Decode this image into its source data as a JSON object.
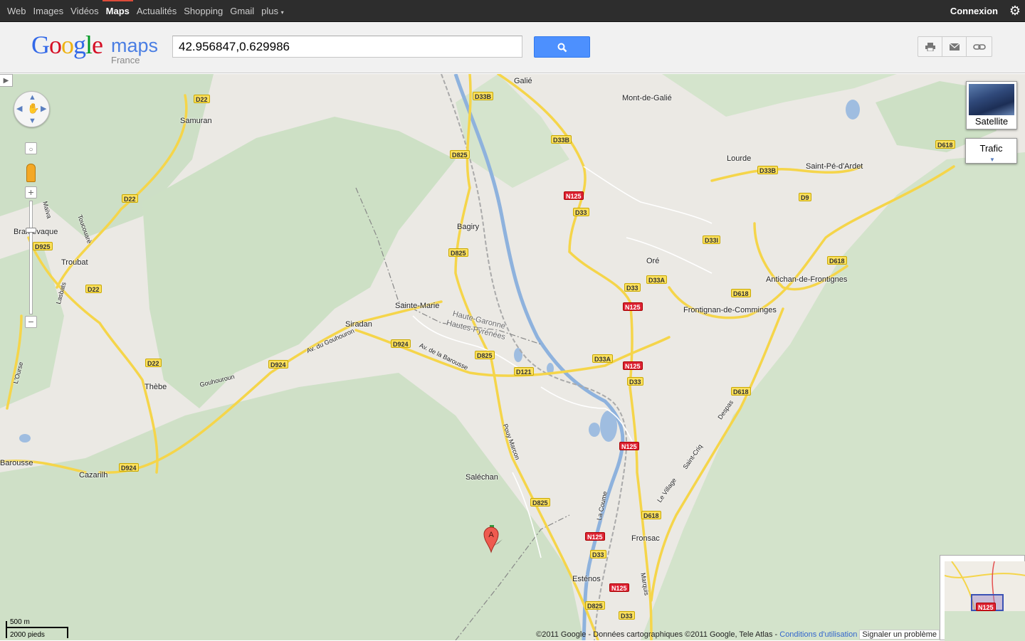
{
  "topbar": {
    "nav": [
      "Web",
      "Images",
      "Vidéos",
      "Maps",
      "Actualités",
      "Shopping",
      "Gmail",
      "plus"
    ],
    "active": "Maps",
    "signin": "Connexion",
    "settings_icon": "gear-icon"
  },
  "header": {
    "logo_google": "Google",
    "logo_maps": "maps",
    "logo_region": "France",
    "search_value": "42.956847,0.629986",
    "search_button_icon": "search-icon",
    "tools": [
      "print-icon",
      "email-icon",
      "link-icon"
    ]
  },
  "map": {
    "places": [
      "Galié",
      "Mont-de-Galié",
      "Samuran",
      "Lourde",
      "Saint-Pé-d'Ardet",
      "Bagiry",
      "Oré",
      "Antichan-de-Frontignes",
      "Frontignan-de-Comminges",
      "Sainte-Marie",
      "Siradan",
      "Troubat",
      "Bramevaque",
      "Thèbe",
      "Cazarilh",
      "Saléchan",
      "Fronsac",
      "Esténos",
      "Barousse",
      "Haute-Garonne",
      "Hautes-Pyrénées"
    ],
    "roads": [
      "D22",
      "D33B",
      "D825",
      "N125",
      "D33",
      "D618",
      "D9",
      "D33I",
      "D33A",
      "D121",
      "D924",
      "D925",
      "Av. du Gouhouron",
      "Av. de la Barousse",
      "Gouhouroun",
      "Pouy Marcon",
      "La Coume",
      "Le Village",
      "Saint-Criq",
      "Despas",
      "Marquis",
      "Toucouarè",
      "L'Ourse",
      "Lasbats",
      "Maïva"
    ],
    "marker_label": "A",
    "satellite_label": "Satellite",
    "traffic_label": "Trafic",
    "scale_metric": "500 m",
    "scale_imperial": "2000 pieds",
    "copyright": "©2011 Google - Données cartographiques ©2011 Google, Tele Atlas -",
    "terms_link": "Conditions d'utilisation",
    "report_link": "Signaler un problème",
    "overview_road": "N125"
  }
}
